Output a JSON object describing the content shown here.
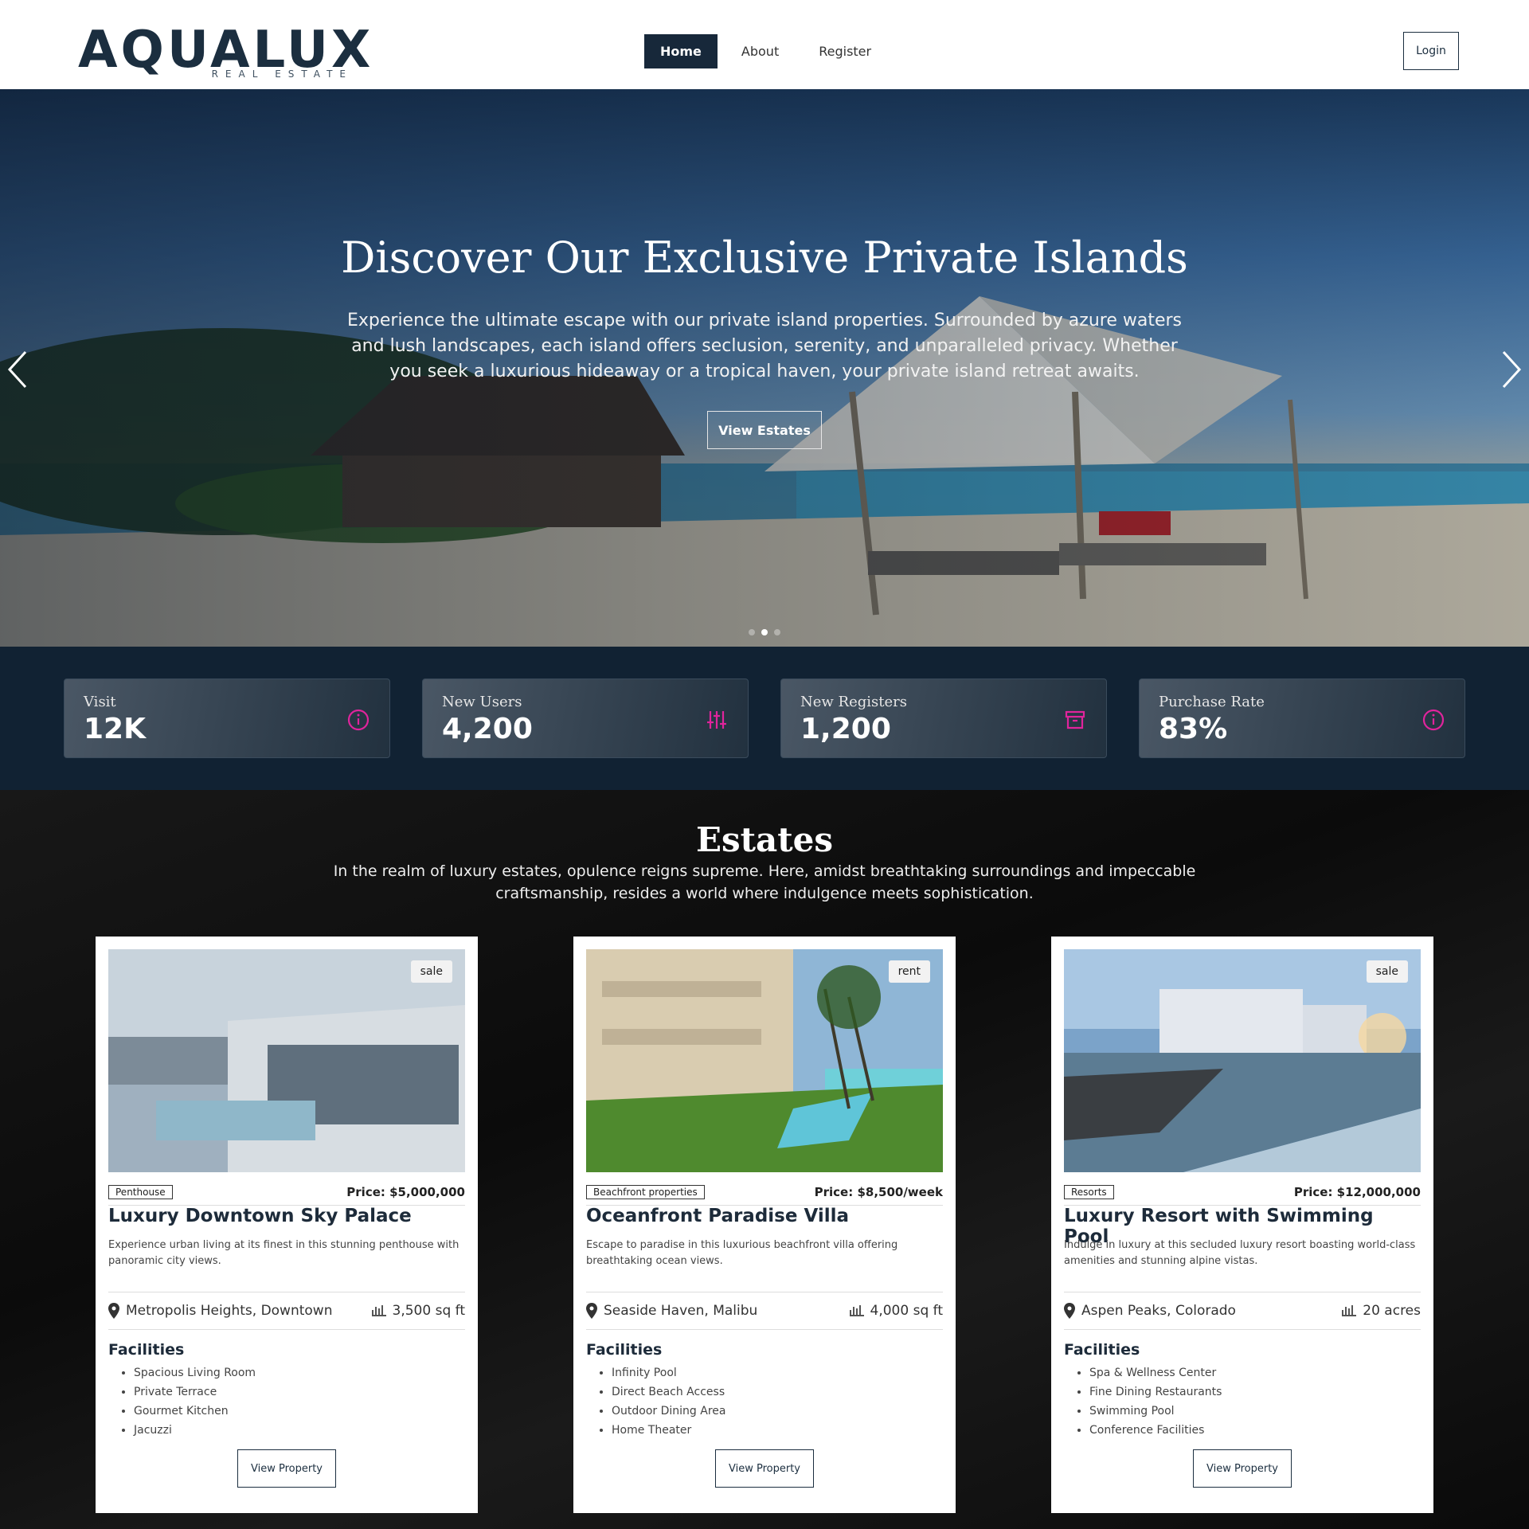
{
  "nav": {
    "logo_main": "AQUALUX",
    "logo_sub": "REAL ESTATE",
    "links": [
      "Home",
      "About",
      "Register"
    ],
    "login": "Login"
  },
  "hero": {
    "title": "Discover Our Exclusive Private Islands",
    "text": "Experience the ultimate escape with our private island properties. Surrounded by azure waters and lush landscapes, each island offers seclusion, serenity, and unparalleled privacy. Whether you seek a luxurious hideaway or a tropical haven, your private island retreat awaits.",
    "button": "View Estates",
    "prev_icon": "chevron-left-icon",
    "next_icon": "chevron-right-icon"
  },
  "stats": [
    {
      "label": "Visit",
      "value": "12K",
      "icon": "info-icon"
    },
    {
      "label": "New Users",
      "value": "4,200",
      "icon": "sliders-icon"
    },
    {
      "label": "New Registers",
      "value": "1,200",
      "icon": "archive-icon"
    },
    {
      "label": "Purchase Rate",
      "value": "83%",
      "icon": "info-icon"
    }
  ],
  "colors": {
    "accent_icon": "#e0249c",
    "nav_active": "#17283a",
    "stats_bg": "#112233"
  },
  "estates": {
    "title": "Estates",
    "description": "In the realm of luxury estates, opulence reigns supreme. Here, amidst breathtaking surroundings and impeccable craftsmanship, resides a world where indulgence meets sophistication.",
    "facilities_label": "Facilities",
    "view_label": "View Property",
    "cards": [
      {
        "badge": "sale",
        "tag": "Penthouse",
        "price": "Price: $5,000,000",
        "title": "Luxury Downtown Sky Palace",
        "description": "Experience urban living at its finest in this stunning penthouse with panoramic city views.",
        "location": "Metropolis Heights, Downtown",
        "size": "3,500 sq ft",
        "facilities": [
          "Spacious Living Room",
          "Private Terrace",
          "Gourmet Kitchen",
          "Jacuzzi"
        ]
      },
      {
        "badge": "rent",
        "tag": "Beachfront properties",
        "price": "Price: $8,500/week",
        "title": "Oceanfront Paradise Villa",
        "description": "Escape to paradise in this luxurious beachfront villa offering breathtaking ocean views.",
        "location": "Seaside Haven, Malibu",
        "size": "4,000 sq ft",
        "facilities": [
          "Infinity Pool",
          "Direct Beach Access",
          "Outdoor Dining Area",
          "Home Theater"
        ]
      },
      {
        "badge": "sale",
        "tag": "Resorts",
        "price": "Price: $12,000,000",
        "title": "Luxury Resort with Swimming Pool",
        "description": "Indulge in luxury at this secluded luxury resort boasting world-class amenities and stunning alpine vistas.",
        "location": "Aspen Peaks, Colorado",
        "size": "20 acres",
        "facilities": [
          "Spa & Wellness Center",
          "Fine Dining Restaurants",
          "Swimming Pool",
          "Conference Facilities"
        ]
      }
    ]
  }
}
